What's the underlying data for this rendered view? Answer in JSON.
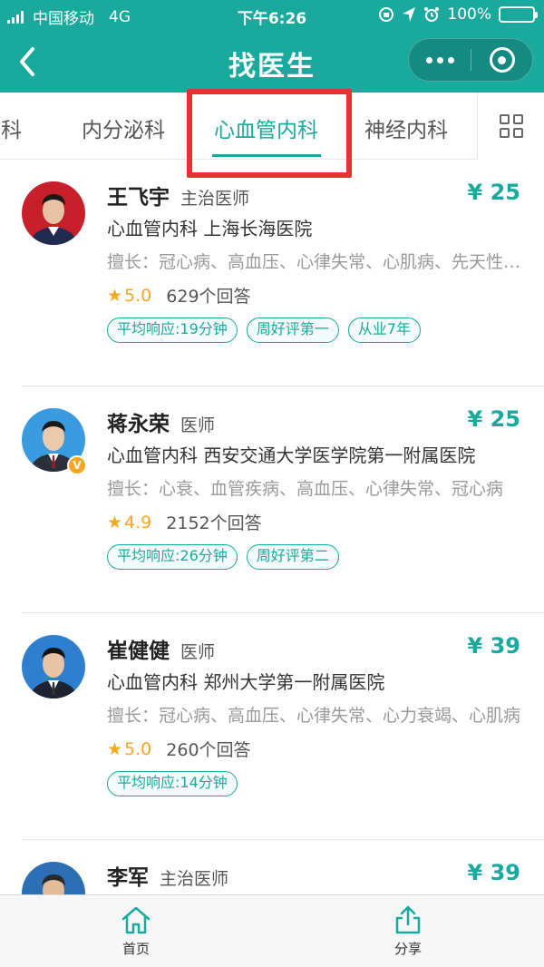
{
  "status_bar": {
    "carrier": "中国移动",
    "network": "4G",
    "time": "下午6:26",
    "battery": "100%",
    "icons": [
      "signal-icon",
      "rotation-lock-icon",
      "location-icon",
      "alarm-icon",
      "battery-icon"
    ]
  },
  "header": {
    "title": "找医生",
    "back_icon": "chevron-left-icon",
    "more_icon": "more-dots-icon",
    "close_icon": "close-target-icon",
    "colors": {
      "header_bg": "#1aa99d",
      "accent": "#1aa99d",
      "highlight": "#e5342f",
      "star": "#f5a623"
    }
  },
  "tabs": {
    "items": [
      {
        "label": "骨科",
        "active": false
      },
      {
        "label": "内分泌科",
        "active": false
      },
      {
        "label": "心血管内科",
        "active": true
      },
      {
        "label": "神经内科",
        "active": false
      }
    ],
    "grid_icon": "grid-icon"
  },
  "doctors": [
    {
      "name": "王飞宇",
      "title": "主治医师",
      "price": "¥ 25",
      "department_hospital": "心血管内科  上海长海医院",
      "specialty": "擅长：冠心病、高血压、心律失常、心肌病、先天性心脏病",
      "rating": "5.0",
      "answers": "629个回答",
      "tags": [
        "平均响应:19分钟",
        "周好评第一",
        "从业7年"
      ],
      "verified": false
    },
    {
      "name": "蒋永荣",
      "title": "医师",
      "price": "¥ 25",
      "department_hospital": "心血管内科  西安交通大学医学院第一附属医院",
      "specialty": "擅长：心衰、血管疾病、高血压、心律失常、冠心病",
      "rating": "4.9",
      "answers": "2152个回答",
      "tags": [
        "平均响应:26分钟",
        "周好评第二"
      ],
      "verified": true
    },
    {
      "name": "崔健健",
      "title": "医师",
      "price": "¥ 39",
      "department_hospital": "心血管内科  郑州大学第一附属医院",
      "specialty": "擅长：冠心病、高血压、心律失常、心力衰竭、心肌病",
      "rating": "5.0",
      "answers": "260个回答",
      "tags": [
        "平均响应:14分钟"
      ],
      "verified": false
    },
    {
      "name": "李军",
      "title": "主治医师",
      "price": "¥ 39",
      "department_hospital": "",
      "specialty": "",
      "rating": "",
      "answers": "",
      "tags": [],
      "verified": false
    }
  ],
  "bottom_bar": {
    "home_label": "首页",
    "home_icon": "home-icon",
    "share_label": "分享",
    "share_icon": "share-icon"
  }
}
